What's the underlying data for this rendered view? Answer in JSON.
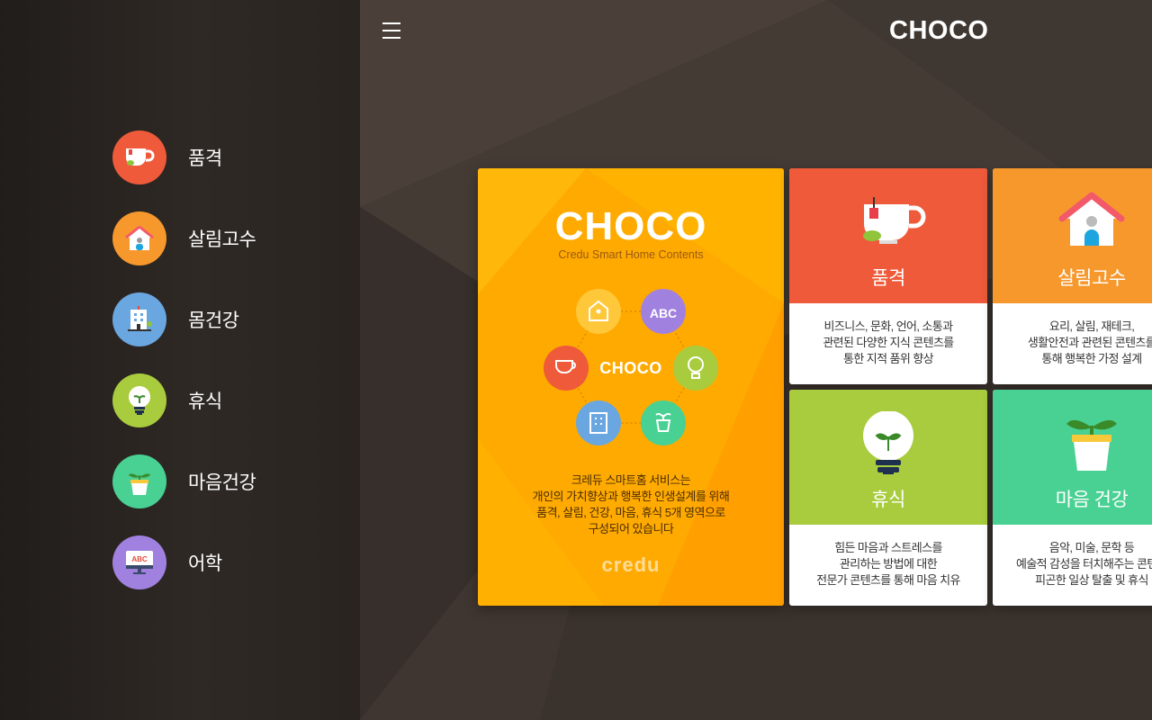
{
  "header": {
    "logo": "CHOCO"
  },
  "sidebar": {
    "items": [
      {
        "label": "품격",
        "icon": "teacup-icon",
        "color": "#ee5a3a"
      },
      {
        "label": "살림고수",
        "icon": "house-icon",
        "color": "#f7982d"
      },
      {
        "label": "몸건강",
        "icon": "hospital-icon",
        "color": "#6aa6e0"
      },
      {
        "label": "휴식",
        "icon": "lightbulb-icon",
        "color": "#a8cc3e"
      },
      {
        "label": "마음건강",
        "icon": "plant-pot-icon",
        "color": "#49d093"
      },
      {
        "label": "어학",
        "icon": "abc-monitor-icon",
        "color": "#a181e0"
      }
    ]
  },
  "feature": {
    "title": "CHOCO",
    "subtitle": "Credu Smart Home Contents",
    "center_logo": "CHOCO",
    "desc_lines": [
      "크레듀 스마트홈 서비스는",
      "개인의 가치향상과 행복한 인생설계를 위해",
      "품격, 살림, 건강, 마음, 휴식 5개 영역으로",
      "구성되어 있습니다"
    ],
    "brand": "credu",
    "color": "#ffa800"
  },
  "tiles": [
    {
      "title": "품격",
      "icon": "teacup-icon",
      "color": "#ee5a3a",
      "lines": [
        "비즈니스, 문화, 언어, 소통과",
        "관련된 다양한 지식 콘텐츠를",
        "통한 지적 품위 향상"
      ]
    },
    {
      "title": "살림고수",
      "icon": "house-icon",
      "color": "#f7982d",
      "lines": [
        "요리, 살림, 재테크,",
        "생활안전과 관련된 콘텐츠를",
        "통해 행복한 가정 설계"
      ]
    },
    {
      "title": "휴식",
      "icon": "lightbulb-icon",
      "color": "#a8cc3e",
      "lines": [
        "힘든 마음과 스트레스를",
        "관리하는 방법에 대한",
        "전문가 콘텐츠를 통해 마음 치유"
      ]
    },
    {
      "title": "마음 건강",
      "icon": "plant-pot-icon",
      "color": "#49d093",
      "lines": [
        "음악, 미술, 문학 등",
        "예술적 감성을 터치해주는 콘텐츠",
        "피곤한 일상 탈출 및 휴식"
      ]
    }
  ]
}
